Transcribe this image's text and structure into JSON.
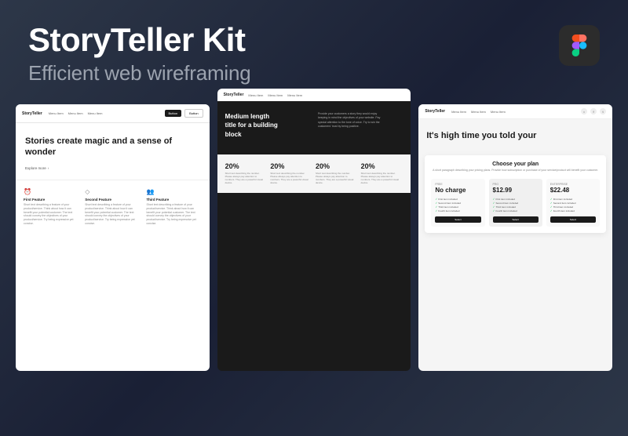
{
  "header": {
    "title": "StoryTeller Kit",
    "subtitle": "Efficient web wireframing",
    "figma_alt": "Figma logo"
  },
  "screenshots": {
    "left": {
      "nav": {
        "brand": "StoryTeller",
        "items": [
          "Menu Item",
          "Menu Item",
          "Menu Item"
        ],
        "buttons": [
          "Button",
          "Button"
        ]
      },
      "hero": {
        "title": "Stories create magic and a sense of wonder",
        "explore": "Explore more"
      },
      "features": [
        {
          "icon": "⏰",
          "title": "First Feature",
          "text": "Short text describing a feature of your product/service. Think about how it can benefit your potential customer. The text should convey the objectives of your product/service. Try being expressive yet concise."
        },
        {
          "icon": "◇",
          "title": "Second Feature",
          "text": "Short text describing a feature of your product/service. Think about how it can benefit your potential customer. The text should convey the objectives of your product/service. Try being expressive yet concise."
        },
        {
          "icon": "👥",
          "title": "Third Feature",
          "text": "Short text describing a feature of your product/service. Think about how it can benefit your potential customer. The text should convey the objectives of your product/service. Try being expressive yet concise."
        }
      ]
    },
    "middle": {
      "nav": {
        "brand": "StoryTeller",
        "items": [
          "Menu Item",
          "Menu Item",
          "Menu Item"
        ]
      },
      "dark_section": {
        "title": "Medium length title for a building block",
        "text": "Provide your customers a story they would enjoy keeping in mind the objectives of your website. Pay special attention to the tone of voice. Try to win the customers' trust by being positive."
      },
      "stats": [
        {
          "number": "20%",
          "text": "Short text describing the number. Please always pay attention to numbers. They are a powerful visual device."
        },
        {
          "number": "20%",
          "text": "Short text describing the number. Please always pay attention to numbers. They are a powerful visual device."
        },
        {
          "number": "20%",
          "text": "Short text describing the number. Please always pay attention to numbers. They are a powerful visual device."
        },
        {
          "number": "20%",
          "text": "Short text describing the number. Please always pay attention to numbers. They are a powerful visual device."
        }
      ]
    },
    "right": {
      "nav": {
        "brand": "StoryTeller",
        "items": [
          "Menu Item",
          "Menu Item",
          "Menu Item"
        ],
        "social": [
          "○",
          "f",
          "t"
        ]
      },
      "hero": {
        "title": "It's high time you told your"
      },
      "pricing": {
        "title": "Choose your plan",
        "subtitle": "A short paragraph describing your pricing plans. Provide how subscription or purchase of your service/product will benefit your customer.",
        "plans": [
          {
            "tier": "FREE",
            "price": "No charge",
            "features": [
              "First item included",
              "Second item included",
              "Third item included",
              "Fourth item included"
            ],
            "button": "Select"
          },
          {
            "tier": "PRO",
            "price": "$12.99",
            "features": [
              "First item included",
              "Second item included",
              "Third item included",
              "Fourth item included"
            ],
            "button": "Select"
          },
          {
            "tier": "ENTERPRISE",
            "price": "$22.48",
            "features": [
              "First item included",
              "Second item included",
              "Third item included",
              "Fourth item included"
            ],
            "button": "Select"
          }
        ]
      }
    }
  }
}
